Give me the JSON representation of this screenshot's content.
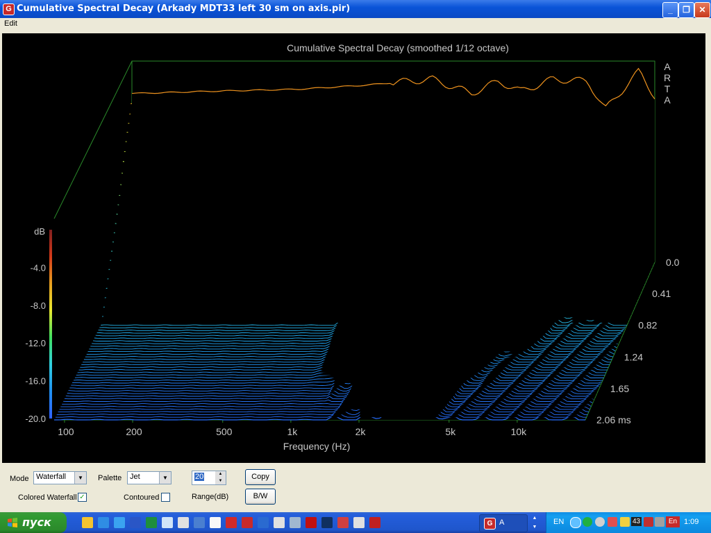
{
  "window": {
    "title": "Cumulative Spectral Decay  (Arkady MDT33 left 30 sm on axis.pir)",
    "app_icon_letter": "G",
    "minimize_glyph": "_",
    "maximize_glyph": "❐",
    "close_glyph": "✕"
  },
  "menu": {
    "items": [
      "Edit"
    ]
  },
  "chart_data": {
    "type": "waterfall",
    "title": "Cumulative Spectral Decay (smoothed 1/12 octave)",
    "watermark": "A\nR\nT\nA",
    "xlabel": "Frequency (Hz)",
    "ylabel": "dB",
    "zlabel": "ms",
    "x_scale": "log",
    "xlim": [
      90,
      20000
    ],
    "ylim": [
      -20,
      0
    ],
    "zlim": [
      0,
      2.06
    ],
    "x_ticks": [
      {
        "value": 100,
        "label": "100"
      },
      {
        "value": 200,
        "label": "200"
      },
      {
        "value": 500,
        "label": "500"
      },
      {
        "value": 1000,
        "label": "1k"
      },
      {
        "value": 2000,
        "label": "2k"
      },
      {
        "value": 5000,
        "label": "5k"
      },
      {
        "value": 10000,
        "label": "10k"
      }
    ],
    "y_ticks": [
      {
        "value": -4.0,
        "label": "-4.0"
      },
      {
        "value": -8.0,
        "label": "-8.0"
      },
      {
        "value": -12.0,
        "label": "-12.0"
      },
      {
        "value": -16.0,
        "label": "-16.0"
      },
      {
        "value": -20.0,
        "label": "-20.0"
      }
    ],
    "time_ticks": [
      {
        "value": 0.0,
        "label": "0.0"
      },
      {
        "value": 0.41,
        "label": "0.41"
      },
      {
        "value": 0.82,
        "label": "0.82"
      },
      {
        "value": 1.24,
        "label": "1.24"
      },
      {
        "value": 1.65,
        "label": "1.65"
      },
      {
        "value": 2.06,
        "label": "2.06 ms"
      }
    ],
    "palette": "Jet",
    "colorbar": [
      "#7f1f1f",
      "#d43a1a",
      "#e8a020",
      "#e8e830",
      "#40e060",
      "#30d0e0",
      "#2090f0",
      "#3060ff"
    ],
    "series": [
      {
        "t": 0.0,
        "points": [
          [
            100,
            -3.2
          ],
          [
            200,
            -3.0
          ],
          [
            500,
            -2.8
          ],
          [
            1000,
            -2.4
          ],
          [
            2000,
            -1.8
          ],
          [
            3000,
            -3.2
          ],
          [
            4000,
            -2.0
          ],
          [
            5000,
            -3.0
          ],
          [
            7000,
            -1.8
          ],
          [
            10000,
            -2.0
          ],
          [
            12000,
            -4.8
          ],
          [
            17000,
            -1.0
          ],
          [
            20000,
            -3.5
          ]
        ]
      },
      {
        "t": 0.08,
        "points": [
          [
            100,
            -5.0
          ],
          [
            200,
            -5.0
          ],
          [
            500,
            -4.8
          ],
          [
            1000,
            -4.2
          ],
          [
            2000,
            -3.2
          ],
          [
            3000,
            -5.2
          ],
          [
            4000,
            -3.4
          ],
          [
            5000,
            -4.8
          ],
          [
            7000,
            -3.0
          ],
          [
            10000,
            -3.2
          ],
          [
            12000,
            -5.8
          ],
          [
            17000,
            -2.2
          ],
          [
            20000,
            -5.0
          ]
        ]
      },
      {
        "t": 0.16,
        "points": [
          [
            100,
            -6.5
          ],
          [
            200,
            -6.5
          ],
          [
            500,
            -6.2
          ],
          [
            1000,
            -5.8
          ],
          [
            2000,
            -4.2
          ],
          [
            3000,
            -6.2
          ],
          [
            4000,
            -4.6
          ],
          [
            5000,
            -5.8
          ],
          [
            7000,
            -4.2
          ],
          [
            10000,
            -6.0
          ],
          [
            12000,
            -6.4
          ],
          [
            17000,
            -3.8
          ],
          [
            20000,
            -6.5
          ]
        ]
      },
      {
        "t": 0.24,
        "points": [
          [
            100,
            -8.2
          ],
          [
            200,
            -8.2
          ],
          [
            500,
            -8.0
          ],
          [
            1000,
            -7.0
          ],
          [
            2000,
            -5.2
          ],
          [
            3000,
            -7.5
          ],
          [
            4000,
            -6.0
          ],
          [
            5000,
            -7.0
          ],
          [
            7000,
            -5.8
          ],
          [
            10000,
            -8.5
          ],
          [
            12000,
            -8.0
          ],
          [
            17000,
            -5.2
          ],
          [
            20000,
            -8.2
          ]
        ]
      },
      {
        "t": 0.33,
        "points": [
          [
            100,
            -10.5
          ],
          [
            200,
            -10.5
          ],
          [
            500,
            -10.3
          ],
          [
            1000,
            -9.4
          ],
          [
            2000,
            -6.6
          ],
          [
            3000,
            -8.8
          ],
          [
            4000,
            -7.6
          ],
          [
            5000,
            -8.8
          ],
          [
            7000,
            -7.8
          ],
          [
            10000,
            -10.5
          ],
          [
            12000,
            -10.0
          ],
          [
            17000,
            -6.8
          ],
          [
            20000,
            -10.5
          ]
        ]
      },
      {
        "t": 0.45,
        "points": [
          [
            100,
            -12.8
          ],
          [
            200,
            -12.8
          ],
          [
            500,
            -12.6
          ],
          [
            1000,
            -12.4
          ],
          [
            1500,
            -12.0
          ],
          [
            2000,
            -9.0
          ],
          [
            3000,
            -10.2
          ],
          [
            4000,
            -9.4
          ],
          [
            5000,
            -10.2
          ],
          [
            7000,
            -10.0
          ],
          [
            10000,
            -13.0
          ],
          [
            12000,
            -13.5
          ],
          [
            17000,
            -9.0
          ],
          [
            20000,
            -14.0
          ]
        ]
      },
      {
        "t": 0.62,
        "points": [
          [
            100,
            -16.0
          ],
          [
            200,
            -16.0
          ],
          [
            500,
            -15.8
          ],
          [
            1000,
            -15.0
          ],
          [
            1500,
            -13.5
          ],
          [
            2000,
            -11.5
          ],
          [
            3000,
            -12.2
          ],
          [
            4000,
            -11.5
          ],
          [
            5000,
            -12.5
          ],
          [
            7000,
            -13.5
          ],
          [
            10000,
            -18.0
          ],
          [
            12000,
            -19.5
          ],
          [
            17000,
            -12.0
          ],
          [
            20000,
            -17.0
          ]
        ]
      },
      {
        "t": 0.82,
        "points": [
          [
            100,
            -20.0
          ],
          [
            200,
            -20.0
          ],
          [
            500,
            -20.0
          ],
          [
            1000,
            -20.0
          ],
          [
            1500,
            -16.5
          ],
          [
            2000,
            -13.5
          ],
          [
            3000,
            -14.0
          ],
          [
            4000,
            -13.5
          ],
          [
            5000,
            -15.0
          ],
          [
            7000,
            -17.5
          ],
          [
            10000,
            -20.0
          ],
          [
            12000,
            -20.0
          ],
          [
            17000,
            -20.0
          ],
          [
            20000,
            -20.0
          ]
        ]
      },
      {
        "t": 1.24,
        "points": [
          [
            100,
            -20.0
          ],
          [
            1000,
            -20.0
          ],
          [
            1500,
            -18.0
          ],
          [
            2000,
            -15.5
          ],
          [
            3000,
            -16.0
          ],
          [
            4000,
            -16.0
          ],
          [
            5000,
            -18.5
          ],
          [
            7000,
            -20.0
          ],
          [
            20000,
            -20.0
          ]
        ]
      },
      {
        "t": 1.65,
        "points": [
          [
            100,
            -20.0
          ],
          [
            1500,
            -20.0
          ],
          [
            2000,
            -17.5
          ],
          [
            3000,
            -18.0
          ],
          [
            4000,
            -18.0
          ],
          [
            5000,
            -20.0
          ],
          [
            20000,
            -20.0
          ]
        ]
      },
      {
        "t": 2.06,
        "points": [
          [
            100,
            -20.0
          ],
          [
            2000,
            -20.0
          ],
          [
            3000,
            -19.0
          ],
          [
            4000,
            -19.0
          ],
          [
            5000,
            -20.0
          ],
          [
            20000,
            -20.0
          ]
        ]
      }
    ]
  },
  "controls": {
    "mode_label": "Mode",
    "mode_value": "Waterfall",
    "palette_label": "Palette",
    "palette_value": "Jet",
    "range_value": "20",
    "range_label": "Range(dB)",
    "copy_button": "Copy",
    "bw_button": "B/W",
    "colored_waterfall_label": "Colored Waterfall",
    "colored_waterfall_checked": "✓",
    "contoured_label": "Contoured",
    "contoured_checked": "",
    "dropdown_arrow": "▼",
    "spin_up": "▲",
    "spin_down": "▼"
  },
  "taskbar": {
    "start_label": "пуск",
    "task_label": "A",
    "task_icon_letter": "G",
    "lang": "EN",
    "lang2": "En",
    "tray_number": "43",
    "clock": "1:09",
    "quick_icons": [
      "explorer-icon",
      "ie-icon",
      "arrow-icon",
      "word-icon",
      "excel-icon",
      "cloud-icon",
      "calc-icon",
      "media-icon",
      "tool-icon",
      "cherries-icon",
      "ares-icon",
      "isis-icon",
      "doc-icon",
      "cam-icon",
      "red-app-icon",
      "photoshop-icon",
      "target-icon",
      "skull-icon",
      "power-icon"
    ],
    "quick_colors": [
      "#f4c430",
      "#2f8de4",
      "#3aa3f0",
      "#2a56c6",
      "#1e8e3e",
      "#d0e4f8",
      "#e0e0e0",
      "#4a7fd0",
      "#f8f8f8",
      "#d02a2a",
      "#c82a2a",
      "#2a6ad0",
      "#e0e0e0",
      "#a0b8d0",
      "#c01010",
      "#103060",
      "#d04040",
      "#e0e0e0",
      "#c02020"
    ]
  }
}
